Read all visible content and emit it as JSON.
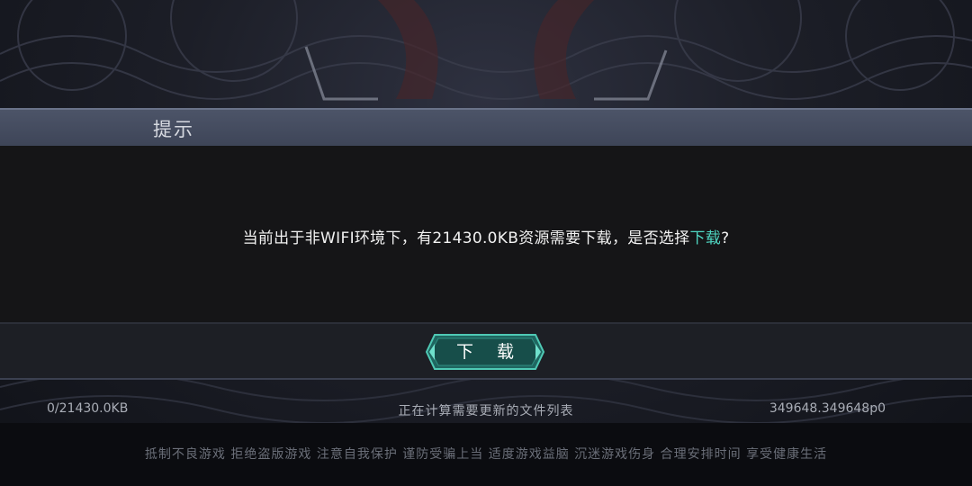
{
  "dialog": {
    "title": "提示",
    "message_prefix": "当前出于非WIFI环境下，有21430.0KB资源需要下载，是否选择",
    "message_highlight": "下载",
    "message_suffix": "?",
    "download_label": "下 载"
  },
  "progress": {
    "downloaded": "0/21430.0KB",
    "status": "正在计算需要更新的文件列表",
    "version": "349648.349648p0"
  },
  "footer": {
    "notice": "抵制不良游戏 拒绝盗版游戏 注意自我保护 谨防受骗上当 适度游戏益脑 沉迷游戏伤身 合理安排时间 享受健康生活"
  },
  "colors": {
    "highlight": "#4fd6c2",
    "button_fill": "#1f6660",
    "button_border": "#4fc9b5"
  }
}
